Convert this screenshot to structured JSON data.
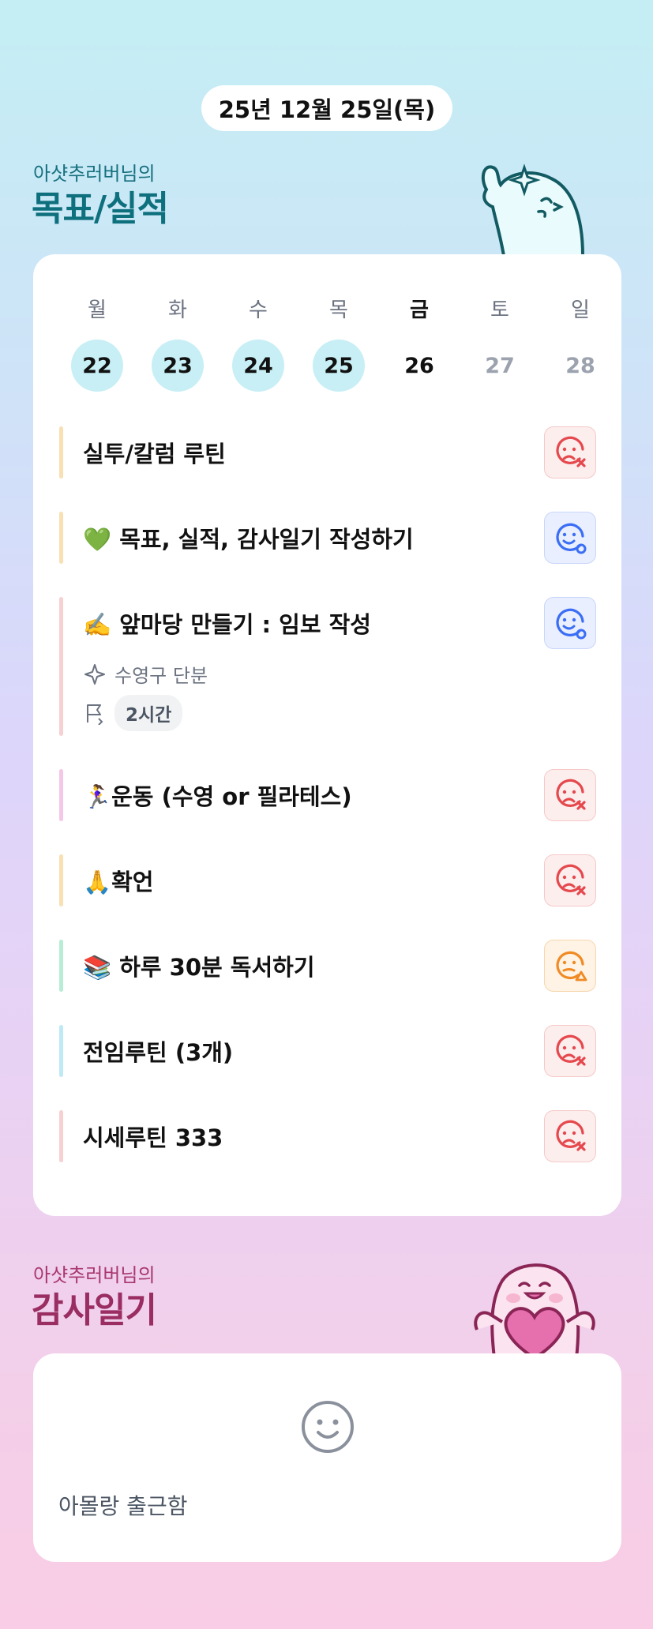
{
  "date_label": "25년 12월 25일(목)",
  "goal_section": {
    "subtitle": "아샷추러버님의",
    "title": "목표/실적"
  },
  "week": {
    "days": [
      "월",
      "화",
      "수",
      "목",
      "금",
      "토",
      "일"
    ],
    "dates": [
      "22",
      "23",
      "24",
      "25",
      "26",
      "27",
      "28"
    ],
    "completed_count": 4,
    "today_index": 4
  },
  "goals": [
    {
      "label": "실투/칼럼 루틴",
      "status": "fail",
      "color": "#f8dfb4"
    },
    {
      "label": "💚 목표, 실적, 감사일기 작성하기",
      "status": "ok",
      "color": "#f8dfb4"
    },
    {
      "label": "✍️ 앞마당 만들기 : 임보 작성",
      "status": "ok",
      "color": "#f7d0d2",
      "tag": "수영구 단분",
      "time": "2시간"
    },
    {
      "label": "🏃‍♀️운동 (수영 or 필라테스)",
      "status": "fail",
      "color": "#f5c7e6"
    },
    {
      "label": "🙏확언",
      "status": "fail",
      "color": "#f8dfb4"
    },
    {
      "label": "📚 하루 30분 독서하기",
      "status": "warn",
      "color": "#b8ecd6"
    },
    {
      "label": "전임루틴 (3개)",
      "status": "fail",
      "color": "#bfe9f4"
    },
    {
      "label": "시세루틴 333",
      "status": "fail",
      "color": "#f7d0d2"
    }
  ],
  "status_colors": {
    "fail": "#e5484d",
    "ok": "#3b6ef5",
    "warn": "#f08a24"
  },
  "diary_section": {
    "subtitle": "아샷추러버님의",
    "title": "감사일기"
  },
  "diary": {
    "text": "아몰랑 출근함",
    "mood_icon": "smile-face-icon"
  }
}
